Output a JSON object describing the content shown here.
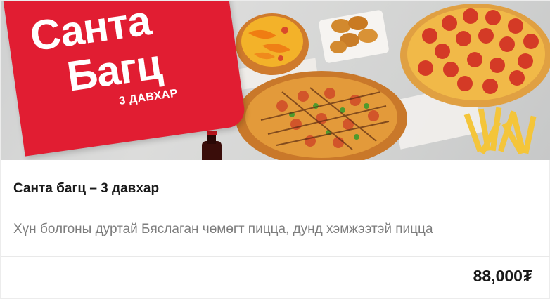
{
  "banner": {
    "line1": "Санта",
    "line2": "Багц",
    "subtitle": "3 ДАВХАР",
    "brand_color": "#e11d32",
    "image_description_icon": "pizza-combo-image"
  },
  "product": {
    "title": "Санта багц – 3 давхар",
    "description": "Хүн болгоны дуртай Бяслаган чөмөгт пицца, дунд хэмжээтэй пицца",
    "price": "88,000₮"
  }
}
